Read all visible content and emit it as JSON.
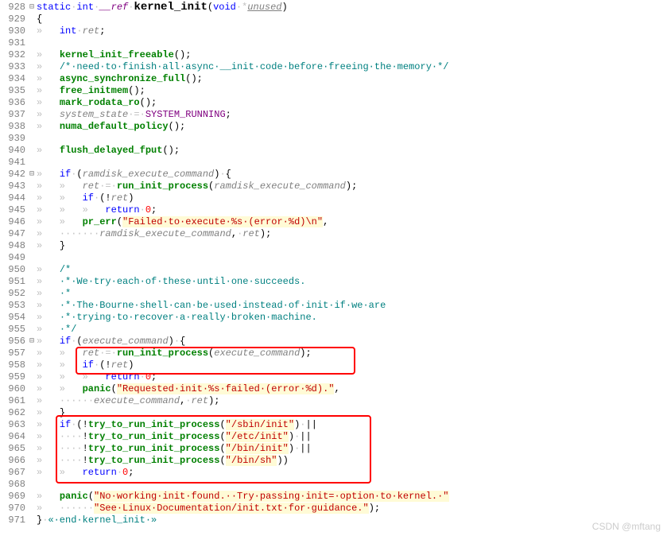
{
  "watermark": "CSDN @mftang",
  "lines": [
    {
      "n": 928,
      "fold": "⊟",
      "tokens": [
        {
          "c": "kw",
          "t": "static"
        },
        {
          "c": "ws",
          "t": "·"
        },
        {
          "c": "kw",
          "t": "int"
        },
        {
          "c": "ws",
          "t": "·"
        },
        {
          "c": "ref",
          "t": "__ref"
        },
        {
          "c": "ws",
          "t": "·"
        },
        {
          "c": "funcdef",
          "t": "kernel_init"
        },
        {
          "c": "punct",
          "t": "("
        },
        {
          "c": "kw",
          "t": "void"
        },
        {
          "c": "ws",
          "t": "·*"
        },
        {
          "c": "param",
          "t": "unused"
        },
        {
          "c": "punct",
          "t": ")"
        }
      ]
    },
    {
      "n": 929,
      "fold": "",
      "tokens": [
        {
          "c": "punct",
          "t": "{"
        }
      ]
    },
    {
      "n": 930,
      "fold": "",
      "tokens": [
        {
          "c": "arrow",
          "t": "»   "
        },
        {
          "c": "kw",
          "t": "int"
        },
        {
          "c": "ws",
          "t": "·"
        },
        {
          "c": "ident",
          "t": "ret"
        },
        {
          "c": "punct",
          "t": ";"
        }
      ]
    },
    {
      "n": 931,
      "fold": "",
      "tokens": []
    },
    {
      "n": 932,
      "fold": "",
      "tokens": [
        {
          "c": "arrow",
          "t": "»   "
        },
        {
          "c": "func",
          "t": "kernel_init_freeable"
        },
        {
          "c": "punct",
          "t": "();"
        }
      ]
    },
    {
      "n": 933,
      "fold": "",
      "tokens": [
        {
          "c": "arrow",
          "t": "»   "
        },
        {
          "c": "comment",
          "t": "/*·need·to·finish·all·async·__init·code·before·freeing·the·memory·*/"
        }
      ]
    },
    {
      "n": 934,
      "fold": "",
      "tokens": [
        {
          "c": "arrow",
          "t": "»   "
        },
        {
          "c": "func",
          "t": "async_synchronize_full"
        },
        {
          "c": "punct",
          "t": "();"
        }
      ]
    },
    {
      "n": 935,
      "fold": "",
      "tokens": [
        {
          "c": "arrow",
          "t": "»   "
        },
        {
          "c": "func",
          "t": "free_initmem"
        },
        {
          "c": "punct",
          "t": "();"
        }
      ]
    },
    {
      "n": 936,
      "fold": "",
      "tokens": [
        {
          "c": "arrow",
          "t": "»   "
        },
        {
          "c": "func",
          "t": "mark_rodata_ro"
        },
        {
          "c": "punct",
          "t": "();"
        }
      ]
    },
    {
      "n": 937,
      "fold": "",
      "tokens": [
        {
          "c": "arrow",
          "t": "»   "
        },
        {
          "c": "ident",
          "t": "system_state"
        },
        {
          "c": "ws",
          "t": "·=·"
        },
        {
          "c": "macro",
          "t": "SYSTEM_RUNNING"
        },
        {
          "c": "punct",
          "t": ";"
        }
      ]
    },
    {
      "n": 938,
      "fold": "",
      "tokens": [
        {
          "c": "arrow",
          "t": "»   "
        },
        {
          "c": "func",
          "t": "numa_default_policy"
        },
        {
          "c": "punct",
          "t": "();"
        }
      ]
    },
    {
      "n": 939,
      "fold": "",
      "tokens": []
    },
    {
      "n": 940,
      "fold": "",
      "tokens": [
        {
          "c": "arrow",
          "t": "»   "
        },
        {
          "c": "func",
          "t": "flush_delayed_fput"
        },
        {
          "c": "punct",
          "t": "();"
        }
      ]
    },
    {
      "n": 941,
      "fold": "",
      "tokens": []
    },
    {
      "n": 942,
      "fold": "⊟",
      "tokens": [
        {
          "c": "arrow",
          "t": "»   "
        },
        {
          "c": "kw",
          "t": "if"
        },
        {
          "c": "ws",
          "t": "·"
        },
        {
          "c": "punct",
          "t": "("
        },
        {
          "c": "ident",
          "t": "ramdisk_execute_command"
        },
        {
          "c": "punct",
          "t": ")"
        },
        {
          "c": "ws",
          "t": "·"
        },
        {
          "c": "punct",
          "t": "{"
        }
      ]
    },
    {
      "n": 943,
      "fold": "",
      "tokens": [
        {
          "c": "arrow",
          "t": "»   »   "
        },
        {
          "c": "ident",
          "t": "ret"
        },
        {
          "c": "ws",
          "t": "·=·"
        },
        {
          "c": "func",
          "t": "run_init_process"
        },
        {
          "c": "punct",
          "t": "("
        },
        {
          "c": "ident",
          "t": "ramdisk_execute_command"
        },
        {
          "c": "punct",
          "t": ");"
        }
      ]
    },
    {
      "n": 944,
      "fold": "",
      "tokens": [
        {
          "c": "arrow",
          "t": "»   »   "
        },
        {
          "c": "kw",
          "t": "if"
        },
        {
          "c": "ws",
          "t": "·"
        },
        {
          "c": "punct",
          "t": "(!"
        },
        {
          "c": "ident",
          "t": "ret"
        },
        {
          "c": "punct",
          "t": ")"
        }
      ]
    },
    {
      "n": 945,
      "fold": "",
      "tokens": [
        {
          "c": "arrow",
          "t": "»   »   »   "
        },
        {
          "c": "kw",
          "t": "return"
        },
        {
          "c": "ws",
          "t": "·"
        },
        {
          "c": "num",
          "t": "0"
        },
        {
          "c": "punct",
          "t": ";"
        }
      ]
    },
    {
      "n": 946,
      "fold": "",
      "tokens": [
        {
          "c": "arrow",
          "t": "»   »   "
        },
        {
          "c": "func",
          "t": "pr_err"
        },
        {
          "c": "punct",
          "t": "("
        },
        {
          "c": "str",
          "t": "\"Failed·to·execute·%s·(error·%d)\\n\""
        },
        {
          "c": "punct",
          "t": ","
        }
      ]
    },
    {
      "n": 947,
      "fold": "",
      "tokens": [
        {
          "c": "arrow",
          "t": "»   "
        },
        {
          "c": "ws",
          "t": "·······"
        },
        {
          "c": "ident",
          "t": "ramdisk_execute_command"
        },
        {
          "c": "punct",
          "t": ","
        },
        {
          "c": "ws",
          "t": "·"
        },
        {
          "c": "ident",
          "t": "ret"
        },
        {
          "c": "punct",
          "t": ");"
        }
      ]
    },
    {
      "n": 948,
      "fold": "",
      "tokens": [
        {
          "c": "arrow",
          "t": "»   "
        },
        {
          "c": "punct",
          "t": "}"
        }
      ]
    },
    {
      "n": 949,
      "fold": "",
      "tokens": []
    },
    {
      "n": 950,
      "fold": "",
      "tokens": [
        {
          "c": "arrow",
          "t": "»   "
        },
        {
          "c": "comment",
          "t": "/*"
        }
      ]
    },
    {
      "n": 951,
      "fold": "",
      "tokens": [
        {
          "c": "arrow",
          "t": "»   "
        },
        {
          "c": "comment",
          "t": "·*·We·try·each·of·these·until·one·succeeds."
        }
      ]
    },
    {
      "n": 952,
      "fold": "",
      "tokens": [
        {
          "c": "arrow",
          "t": "»   "
        },
        {
          "c": "comment",
          "t": "·*"
        }
      ]
    },
    {
      "n": 953,
      "fold": "",
      "tokens": [
        {
          "c": "arrow",
          "t": "»   "
        },
        {
          "c": "comment",
          "t": "·*·The·Bourne·shell·can·be·used·instead·of·init·if·we·are"
        }
      ]
    },
    {
      "n": 954,
      "fold": "",
      "tokens": [
        {
          "c": "arrow",
          "t": "»   "
        },
        {
          "c": "comment",
          "t": "·*·trying·to·recover·a·really·broken·machine."
        }
      ]
    },
    {
      "n": 955,
      "fold": "",
      "tokens": [
        {
          "c": "arrow",
          "t": "»   "
        },
        {
          "c": "comment",
          "t": "·*/"
        }
      ]
    },
    {
      "n": 956,
      "fold": "⊟",
      "tokens": [
        {
          "c": "arrow",
          "t": "»   "
        },
        {
          "c": "kw",
          "t": "if"
        },
        {
          "c": "ws",
          "t": "·"
        },
        {
          "c": "punct",
          "t": "("
        },
        {
          "c": "ident",
          "t": "execute_command"
        },
        {
          "c": "punct",
          "t": ")"
        },
        {
          "c": "ws",
          "t": "·"
        },
        {
          "c": "punct",
          "t": "{"
        }
      ]
    },
    {
      "n": 957,
      "fold": "",
      "tokens": [
        {
          "c": "arrow",
          "t": "»   »   "
        },
        {
          "c": "ident",
          "t": "ret"
        },
        {
          "c": "ws",
          "t": "·=·"
        },
        {
          "c": "func",
          "t": "run_init_process"
        },
        {
          "c": "punct",
          "t": "("
        },
        {
          "c": "ident",
          "t": "execute_command"
        },
        {
          "c": "punct",
          "t": ");"
        }
      ]
    },
    {
      "n": 958,
      "fold": "",
      "tokens": [
        {
          "c": "arrow",
          "t": "»   »   "
        },
        {
          "c": "kw",
          "t": "if"
        },
        {
          "c": "ws",
          "t": "·"
        },
        {
          "c": "punct",
          "t": "(!"
        },
        {
          "c": "ident",
          "t": "ret"
        },
        {
          "c": "punct",
          "t": ")"
        }
      ]
    },
    {
      "n": 959,
      "fold": "",
      "tokens": [
        {
          "c": "arrow",
          "t": "»   »   »   "
        },
        {
          "c": "kw",
          "t": "return"
        },
        {
          "c": "ws",
          "t": "·"
        },
        {
          "c": "num",
          "t": "0"
        },
        {
          "c": "punct",
          "t": ";"
        }
      ]
    },
    {
      "n": 960,
      "fold": "",
      "tokens": [
        {
          "c": "arrow",
          "t": "»   »   "
        },
        {
          "c": "func",
          "t": "panic"
        },
        {
          "c": "punct",
          "t": "("
        },
        {
          "c": "str",
          "t": "\"Requested·init·%s·failed·(error·%d).\""
        },
        {
          "c": "punct",
          "t": ","
        }
      ]
    },
    {
      "n": 961,
      "fold": "",
      "tokens": [
        {
          "c": "arrow",
          "t": "»   "
        },
        {
          "c": "ws",
          "t": "······"
        },
        {
          "c": "ident",
          "t": "execute_command"
        },
        {
          "c": "punct",
          "t": ","
        },
        {
          "c": "ws",
          "t": "·"
        },
        {
          "c": "ident",
          "t": "ret"
        },
        {
          "c": "punct",
          "t": ");"
        }
      ]
    },
    {
      "n": 962,
      "fold": "",
      "tokens": [
        {
          "c": "arrow",
          "t": "»   "
        },
        {
          "c": "punct",
          "t": "}"
        }
      ]
    },
    {
      "n": 963,
      "fold": "",
      "tokens": [
        {
          "c": "arrow",
          "t": "»   "
        },
        {
          "c": "kw",
          "t": "if"
        },
        {
          "c": "ws",
          "t": "·"
        },
        {
          "c": "punct",
          "t": "(!"
        },
        {
          "c": "func",
          "t": "try_to_run_init_process"
        },
        {
          "c": "punct",
          "t": "("
        },
        {
          "c": "str",
          "t": "\"/sbin/init\""
        },
        {
          "c": "punct",
          "t": ")"
        },
        {
          "c": "ws",
          "t": "·"
        },
        {
          "c": "punct",
          "t": "||"
        }
      ]
    },
    {
      "n": 964,
      "fold": "",
      "tokens": [
        {
          "c": "arrow",
          "t": "»   "
        },
        {
          "c": "ws",
          "t": "····"
        },
        {
          "c": "punct",
          "t": "!"
        },
        {
          "c": "func",
          "t": "try_to_run_init_process"
        },
        {
          "c": "punct",
          "t": "("
        },
        {
          "c": "str",
          "t": "\"/etc/init\""
        },
        {
          "c": "punct",
          "t": ")"
        },
        {
          "c": "ws",
          "t": "·"
        },
        {
          "c": "punct",
          "t": "||"
        }
      ]
    },
    {
      "n": 965,
      "fold": "",
      "tokens": [
        {
          "c": "arrow",
          "t": "»   "
        },
        {
          "c": "ws",
          "t": "····"
        },
        {
          "c": "punct",
          "t": "!"
        },
        {
          "c": "func",
          "t": "try_to_run_init_process"
        },
        {
          "c": "punct",
          "t": "("
        },
        {
          "c": "str",
          "t": "\"/bin/init\""
        },
        {
          "c": "punct",
          "t": ")"
        },
        {
          "c": "ws",
          "t": "·"
        },
        {
          "c": "punct",
          "t": "||"
        }
      ]
    },
    {
      "n": 966,
      "fold": "",
      "tokens": [
        {
          "c": "arrow",
          "t": "»   "
        },
        {
          "c": "ws",
          "t": "····"
        },
        {
          "c": "punct",
          "t": "!"
        },
        {
          "c": "func",
          "t": "try_to_run_init_process"
        },
        {
          "c": "punct",
          "t": "("
        },
        {
          "c": "str",
          "t": "\"/bin/sh\""
        },
        {
          "c": "punct",
          "t": "))"
        }
      ]
    },
    {
      "n": 967,
      "fold": "",
      "tokens": [
        {
          "c": "arrow",
          "t": "»   »   "
        },
        {
          "c": "kw",
          "t": "return"
        },
        {
          "c": "ws",
          "t": "·"
        },
        {
          "c": "num",
          "t": "0"
        },
        {
          "c": "punct",
          "t": ";"
        }
      ]
    },
    {
      "n": 968,
      "fold": "",
      "tokens": []
    },
    {
      "n": 969,
      "fold": "",
      "tokens": [
        {
          "c": "arrow",
          "t": "»   "
        },
        {
          "c": "func",
          "t": "panic"
        },
        {
          "c": "punct",
          "t": "("
        },
        {
          "c": "str",
          "t": "\"No·working·init·found.··Try·passing·init=·option·to·kernel.·\""
        }
      ]
    },
    {
      "n": 970,
      "fold": "",
      "tokens": [
        {
          "c": "arrow",
          "t": "»   "
        },
        {
          "c": "ws",
          "t": "······"
        },
        {
          "c": "str",
          "t": "\"See·Linux·Documentation/init.txt·for·guidance.\""
        },
        {
          "c": "punct",
          "t": ");"
        }
      ]
    },
    {
      "n": 971,
      "fold": "",
      "tokens": [
        {
          "c": "punct",
          "t": "}"
        },
        {
          "c": "ws",
          "t": "·"
        },
        {
          "c": "comment",
          "t": "«·end·kernel_init·»"
        }
      ]
    }
  ]
}
